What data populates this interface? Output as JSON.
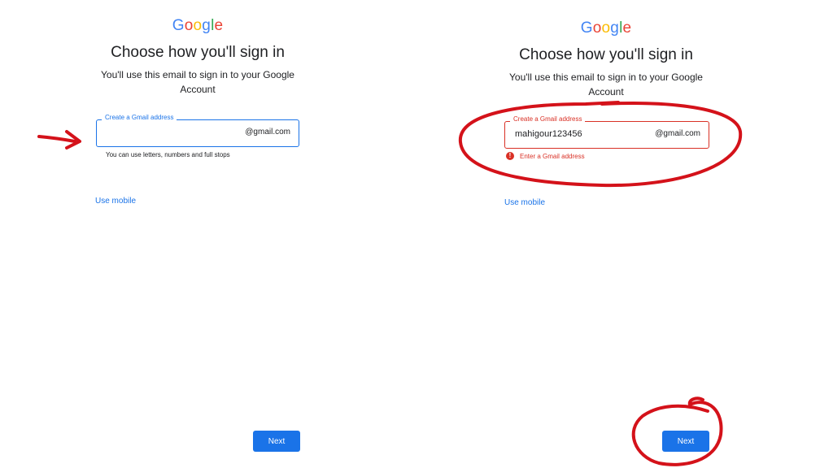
{
  "colors": {
    "google_blue": "#4285F4",
    "google_red": "#EA4335",
    "google_yellow": "#FBBC05",
    "google_green": "#34A853",
    "accent": "#1a73e8",
    "error": "#d93025",
    "annotation": "#d4121a"
  },
  "left": {
    "logo": {
      "g1": "G",
      "o1": "o",
      "o2": "o",
      "g2": "g",
      "l": "l",
      "e": "e"
    },
    "title": "Choose how you'll sign in",
    "subtitle": "You'll use this email to sign in to your Google Account",
    "field": {
      "label": "Create a Gmail address",
      "value": "",
      "suffix": "@gmail.com"
    },
    "hint": "You can use letters, numbers and full stops",
    "use_mobile": "Use mobile",
    "next": "Next"
  },
  "right": {
    "logo": {
      "g1": "G",
      "o1": "o",
      "o2": "o",
      "g2": "g",
      "l": "l",
      "e": "e"
    },
    "title": "Choose how you'll sign in",
    "subtitle": "You'll use this email to sign in to your Google Account",
    "field": {
      "label": "Create a Gmail address",
      "value": "mahigour123456",
      "suffix": "@gmail.com"
    },
    "error": "Enter a Gmail address",
    "use_mobile": "Use mobile",
    "next": "Next"
  },
  "annotations": [
    "arrow-pointing-to-field",
    "circle-around-field",
    "circle-around-next-button"
  ]
}
